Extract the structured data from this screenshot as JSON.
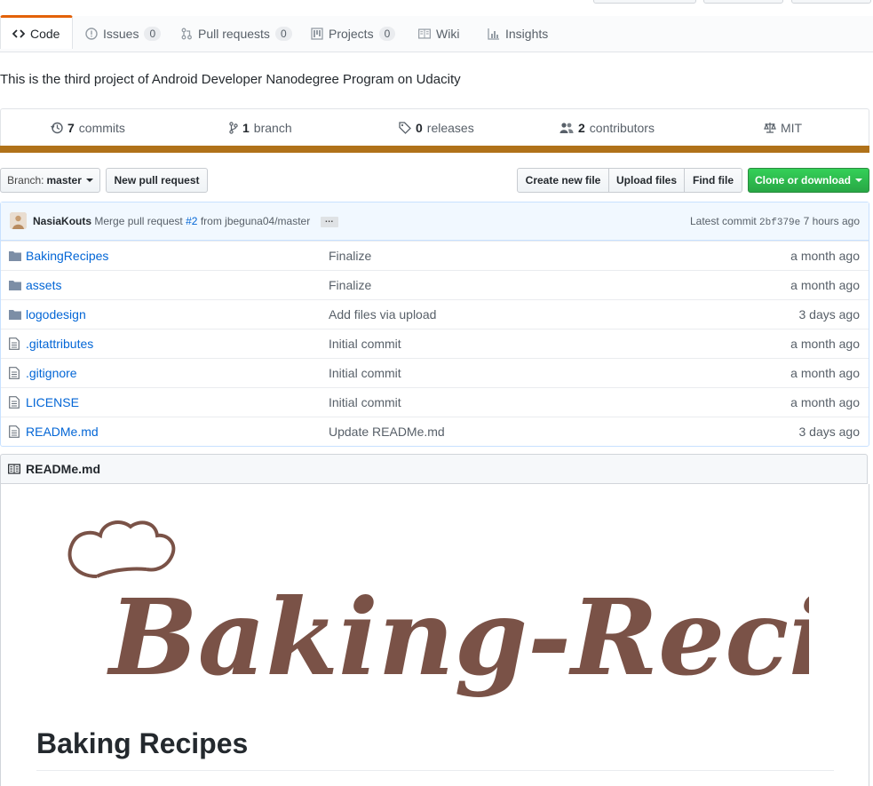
{
  "tabs": [
    {
      "label": "Code",
      "icon": "code-icon",
      "selected": true
    },
    {
      "label": "Issues",
      "icon": "issue-icon",
      "count": "0"
    },
    {
      "label": "Pull requests",
      "icon": "pull-request-icon",
      "count": "0"
    },
    {
      "label": "Projects",
      "icon": "project-icon",
      "count": "0"
    },
    {
      "label": "Wiki",
      "icon": "book-icon"
    },
    {
      "label": "Insights",
      "icon": "graph-icon"
    }
  ],
  "description": "This is the third project of Android Developer Nanodegree Program on Udacity",
  "summary": {
    "commits": {
      "count": "7",
      "label": "commits"
    },
    "branches": {
      "count": "1",
      "label": "branch"
    },
    "releases": {
      "count": "0",
      "label": "releases"
    },
    "contributors": {
      "count": "2",
      "label": "contributors"
    },
    "license": "MIT"
  },
  "language_color": "#b07219",
  "toolbar": {
    "branch_prefix": "Branch:",
    "branch_name": "master",
    "new_pull_request": "New pull request",
    "create_new_file": "Create new file",
    "upload_files": "Upload files",
    "find_file": "Find file",
    "clone_or_download": "Clone or download"
  },
  "latest_commit": {
    "author": "NasiaKouts",
    "message_prefix": "Merge pull request",
    "pr_link": "#2",
    "message_suffix": "from jbeguna04/master",
    "ellipsis": "…",
    "latest_label": "Latest commit",
    "sha": "2bf379e",
    "time": "7 hours ago"
  },
  "files": [
    {
      "name": "BakingRecipes",
      "type": "folder",
      "message": "Finalize",
      "age": "a month ago"
    },
    {
      "name": "assets",
      "type": "folder",
      "message": "Finalize",
      "age": "a month ago"
    },
    {
      "name": "logodesign",
      "type": "folder",
      "message": "Add files via upload",
      "age": "3 days ago"
    },
    {
      "name": ".gitattributes",
      "type": "file",
      "message": "Initial commit",
      "age": "a month ago"
    },
    {
      "name": ".gitignore",
      "type": "file",
      "message": "Initial commit",
      "age": "a month ago"
    },
    {
      "name": "LICENSE",
      "type": "file",
      "message": "Initial commit",
      "age": "a month ago"
    },
    {
      "name": "READMe.md",
      "type": "file",
      "message": "Update READMe.md",
      "age": "3 days ago"
    }
  ],
  "readme": {
    "filename": "READMe.md",
    "logo_text": "Baking-Recipes",
    "logo_color": "#7a5247",
    "heading": "Baking Recipes"
  }
}
